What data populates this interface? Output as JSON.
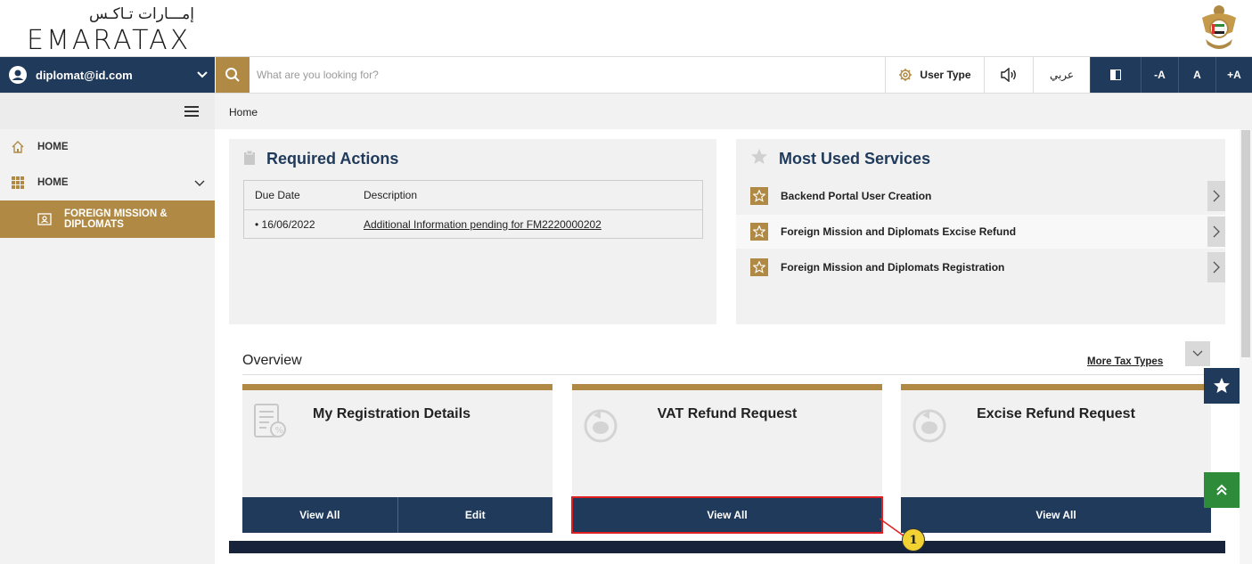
{
  "header": {
    "logo_arabic": "إمـــارات تـاكـس",
    "logo_english": "EMARATAX"
  },
  "topbar": {
    "user_email": "diplomat@id.com",
    "search_placeholder": "What are you looking for?",
    "user_type_label": "User Type",
    "language_label": "عربي",
    "font_decrease": "-A",
    "font_normal": "A",
    "font_increase": "+A"
  },
  "breadcrumb": {
    "current": "Home"
  },
  "sidebar": {
    "items": [
      {
        "label": "HOME"
      },
      {
        "label": "HOME"
      },
      {
        "label": "FOREIGN MISSION &",
        "label2": "DIPLOMATS"
      }
    ]
  },
  "required_actions": {
    "title": "Required Actions",
    "columns": [
      "Due Date",
      "Description"
    ],
    "rows": [
      {
        "due_date": "• 16/06/2022",
        "description": "Additional Information pending for FM2220000202"
      }
    ]
  },
  "most_used_services": {
    "title": "Most Used Services",
    "items": [
      {
        "label": "Backend Portal User Creation"
      },
      {
        "label": "Foreign Mission and Diplomats Excise Refund"
      },
      {
        "label": "Foreign Mission and Diplomats Registration"
      }
    ]
  },
  "overview": {
    "title": "Overview",
    "more_link": "More Tax Types",
    "cards": [
      {
        "title": "My Registration Details",
        "buttons": [
          "View All",
          "Edit"
        ]
      },
      {
        "title": "VAT Refund Request",
        "buttons": [
          "View All"
        ]
      },
      {
        "title": "Excise Refund Request",
        "buttons": [
          "View All"
        ]
      }
    ]
  },
  "annotation": {
    "callout_number": "1",
    "highlight_color": "#e02020"
  },
  "colors": {
    "brand_gold": "#b08a45",
    "brand_navy": "#1f3a5a",
    "scroll_top_green": "#2e8b3a"
  }
}
